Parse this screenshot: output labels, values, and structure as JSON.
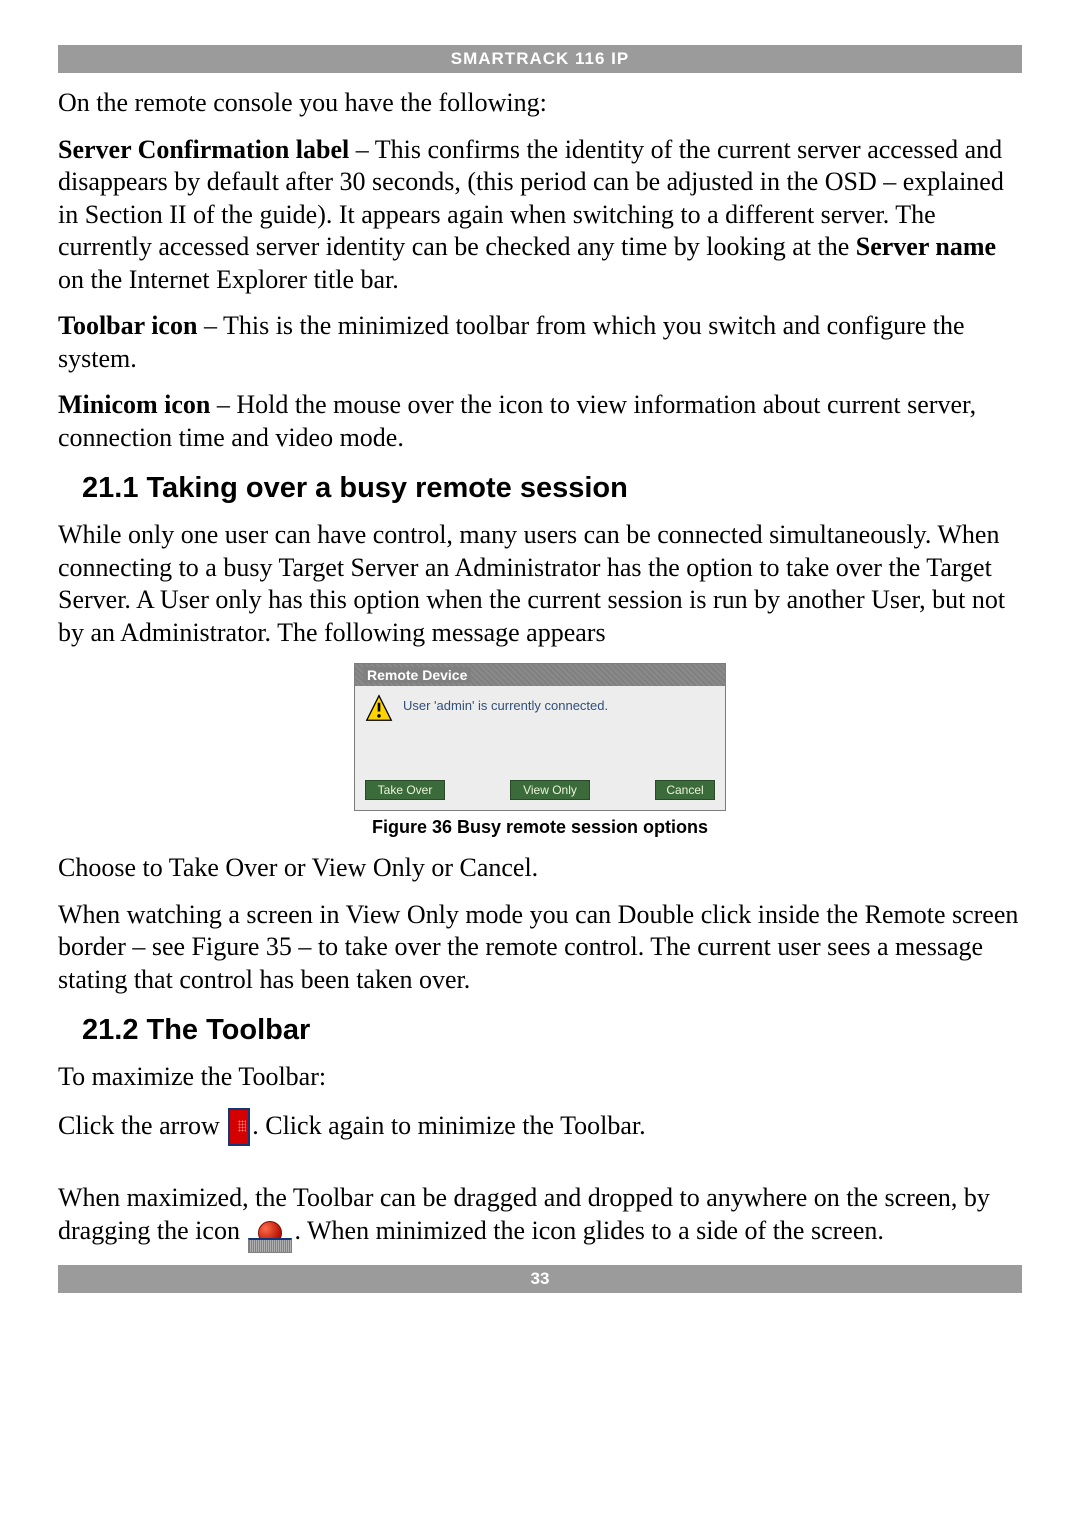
{
  "header": {
    "title": "SMARTRACK 116 IP"
  },
  "footer": {
    "page_number": "33"
  },
  "intro": {
    "line1": "On the remote console you have the following:",
    "p_server_conf_label": "Server Confirmation label",
    "p_server_conf_text_a": " – This confirms the identity of the current server accessed and disappears by default after 30 seconds, (this period can be adjusted in the OSD – explained in Section II of the guide). It appears again when switching to a different server. The currently accessed server identity can be checked any time by looking at the ",
    "p_server_conf_bold_b": "Server name",
    "p_server_conf_text_b": " on the Internet Explorer title bar.",
    "p_toolbar_label": "Toolbar icon",
    "p_toolbar_text": " – This is the minimized toolbar from which you switch and configure the system.",
    "p_minicom_label": "Minicom icon",
    "p_minicom_text": " – Hold the mouse over the icon to view information about current server, connection time and video mode."
  },
  "section_211": {
    "heading": "21.1 Taking over a busy remote session",
    "p1": "While only one user can have control, many users can be connected simultaneously. When connecting to a busy Target Server an Administrator has the option to take over the Target Server. A User only has this option when the current session is run by another User, but not by an Administrator. The following message appears",
    "dialog": {
      "title": "Remote Device",
      "message": "User 'admin' is currently connected.",
      "buttons": {
        "take_over": "Take Over",
        "view_only": "View Only",
        "cancel": "Cancel"
      }
    },
    "caption": "Figure 36 Busy remote session options",
    "p2": "Choose to Take Over or View Only or Cancel.",
    "p3": "When watching a screen in View Only mode you can Double click inside the Remote screen border – see Figure 35 – to take over the remote control. The current user sees a message stating that control has been taken over."
  },
  "section_212": {
    "heading": "21.2 The Toolbar",
    "p1": "To maximize the Toolbar:",
    "p2a": "Click the arrow ",
    "p2b": ". Click again to minimize the Toolbar.",
    "p3a": "When maximized, the Toolbar can be dragged and dropped to anywhere on the screen, by dragging the icon ",
    "p3b": ". When minimized the icon glides to a side of the screen."
  }
}
